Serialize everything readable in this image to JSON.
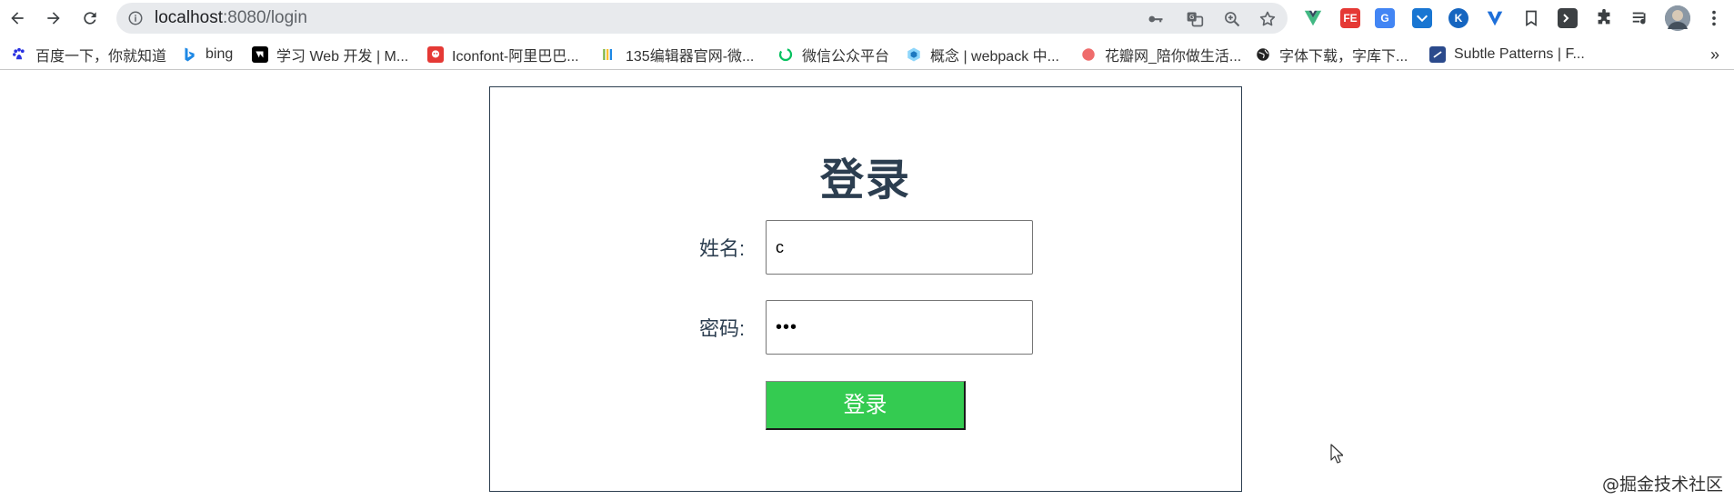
{
  "browser": {
    "url_host": "localhost",
    "url_path": ":8080/login"
  },
  "bookmarks": [
    {
      "label": "百度一下，你就知道",
      "icon": "baidu-paw-icon",
      "color": "#2932e1"
    },
    {
      "label": "bing",
      "icon": "bing-icon",
      "color": "#1e88e5"
    },
    {
      "label": "学习 Web 开发 | M...",
      "icon": "mdn-icon",
      "color": "#000000"
    },
    {
      "label": "Iconfont-阿里巴巴...",
      "icon": "iconfont-icon",
      "color": "#e53935"
    },
    {
      "label": "135编辑器官网-微...",
      "icon": "135-editor-icon",
      "color": "#7cb342"
    },
    {
      "label": "微信公众平台",
      "icon": "wechat-mp-icon",
      "color": "#07c160"
    },
    {
      "label": "概念 | webpack 中...",
      "icon": "webpack-icon",
      "color": "#1e88e5"
    },
    {
      "label": "花瓣网_陪你做生活...",
      "icon": "huaban-icon",
      "color": "#ef6c6c"
    },
    {
      "label": "字体下载，字库下...",
      "icon": "globe-icon",
      "color": "#222222"
    },
    {
      "label": "Subtle Patterns | F...",
      "icon": "subtle-patterns-icon",
      "color": "#2b4a8c"
    }
  ],
  "bookmarks_more": "»",
  "login": {
    "title": "登录",
    "name_label": "姓名:",
    "name_value": "c",
    "password_label": "密码:",
    "password_value": "•••",
    "submit_label": "登录",
    "submit_color": "#34cb51",
    "title_color": "#2c3e50"
  },
  "watermark": "@掘金技术社区"
}
